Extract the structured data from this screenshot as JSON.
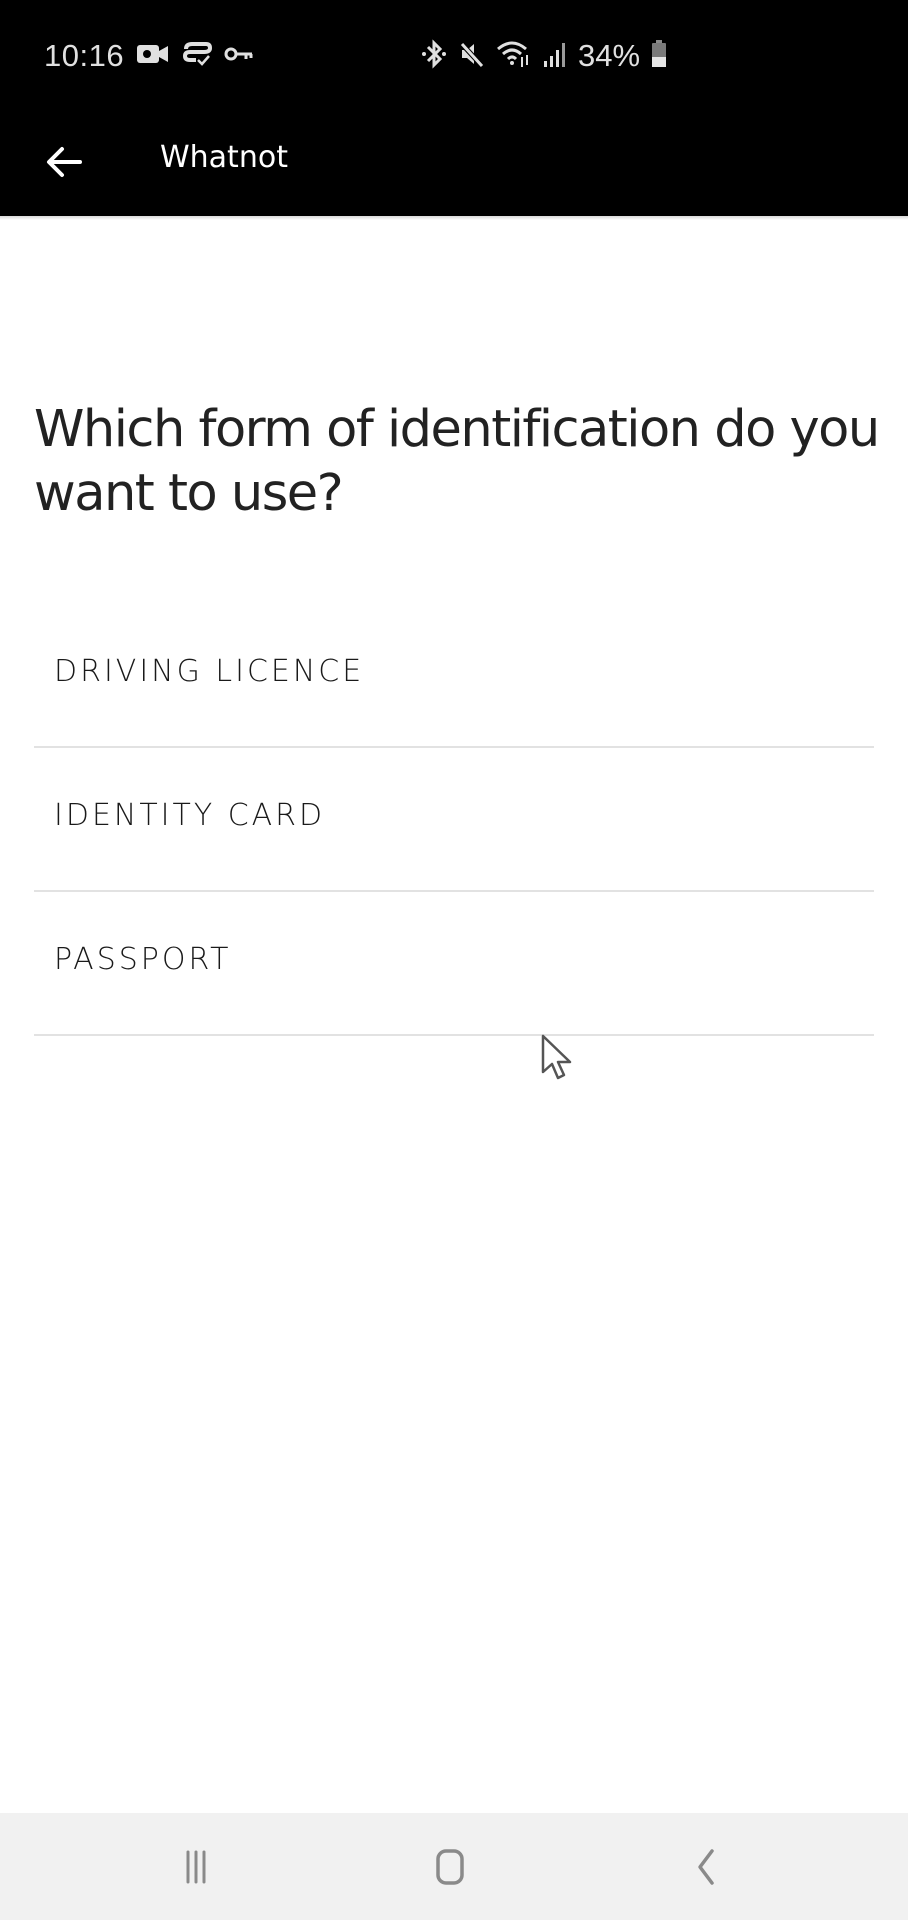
{
  "status_bar": {
    "time": "10:16",
    "left_icons": [
      "video-camera-icon",
      "vpn-check-icon",
      "key-icon"
    ],
    "right_icons": [
      "bluetooth-icon",
      "mute-icon",
      "wifi-icon",
      "signal-icon"
    ],
    "battery_percent": "34%",
    "battery_icon": "battery-icon"
  },
  "app_bar": {
    "back_icon": "arrow-left-icon",
    "title": "Whatnot"
  },
  "main": {
    "question": "Which form of identification do you want to use?",
    "options": [
      {
        "label": "DRIVING LICENCE"
      },
      {
        "label": "IDENTITY CARD"
      },
      {
        "label": "PASSPORT"
      }
    ]
  },
  "nav_bar": {
    "recents_icon": "recents-icon",
    "home_icon": "home-icon",
    "back_icon": "back-chevron-icon"
  },
  "colors": {
    "status_bar_bg": "#000000",
    "app_bar_bg": "#000000",
    "page_bg": "#ffffff",
    "divider": "#e2e2e2",
    "nav_bar_bg": "#f1f1f1",
    "nav_icon": "#8a8a8a"
  }
}
